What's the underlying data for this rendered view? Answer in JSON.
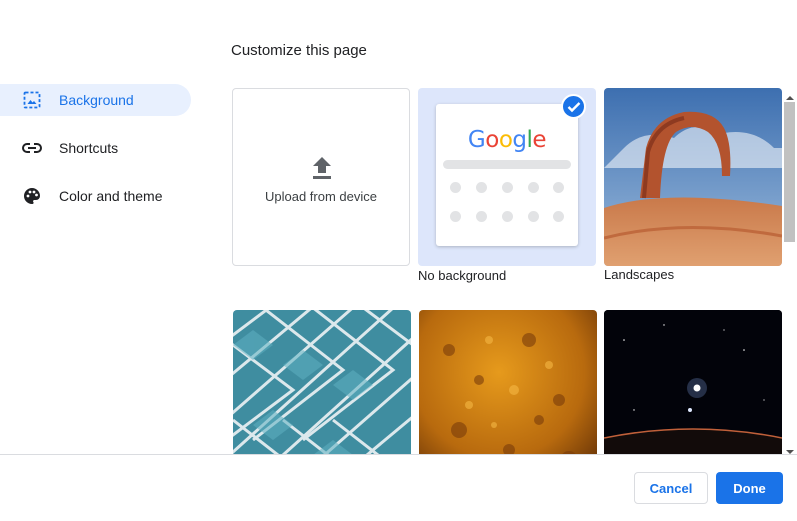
{
  "dialog": {
    "title": "Customize this page"
  },
  "sidebar": {
    "items": [
      {
        "label": "Background",
        "icon": "image-icon",
        "selected": true
      },
      {
        "label": "Shortcuts",
        "icon": "link-icon",
        "selected": false
      },
      {
        "label": "Color and theme",
        "icon": "palette-icon",
        "selected": false
      }
    ]
  },
  "tiles": {
    "upload": {
      "label": "Upload from device",
      "icon": "upload-icon"
    },
    "no_background": {
      "label": "No background",
      "logo": [
        "G",
        "o",
        "o",
        "g",
        "l",
        "e"
      ],
      "selected": true
    },
    "landscapes": {
      "label": "Landscapes"
    }
  },
  "footer": {
    "cancel_label": "Cancel",
    "done_label": "Done"
  },
  "colors": {
    "accent": "#1a73e8",
    "selected_bg": "#e8f0fe",
    "border": "#dadce0"
  }
}
